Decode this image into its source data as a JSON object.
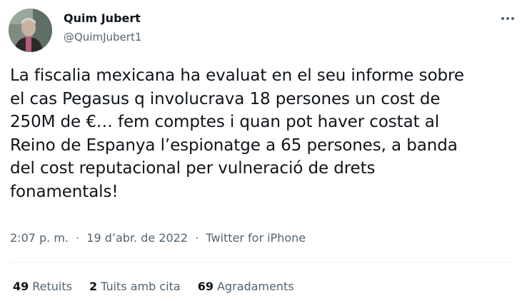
{
  "author": {
    "display_name": "Quim Jubert",
    "handle": "@QuimJubert1",
    "avatar_icon": "profile-photo"
  },
  "more_icon": "ellipsis-icon",
  "tweet": {
    "text": "La fiscalia mexicana ha evaluat en el seu informe sobre\nel cas Pegasus q involucrava 18 persones un cost de\n250M de €… fem comptes i quan pot haver costat al\nReino de Espanya l’espionatge a 65 persones, a banda\ndel cost reputacional per vulneració de drets\nfonamentals!"
  },
  "meta": {
    "time": "2:07 p. m.",
    "sep1": "·",
    "date": "19 d’abr. de 2022",
    "sep2": "·",
    "source": "Twitter for iPhone"
  },
  "stats": {
    "retweets_count": "49",
    "retweets_label": "Retuits",
    "quotes_count": "2",
    "quotes_label": "Tuits amb cita",
    "likes_count": "69",
    "likes_label": "Agradaments"
  },
  "colors": {
    "text_primary": "#0f1419",
    "text_secondary": "#536471",
    "divider": "#eff3f4"
  }
}
